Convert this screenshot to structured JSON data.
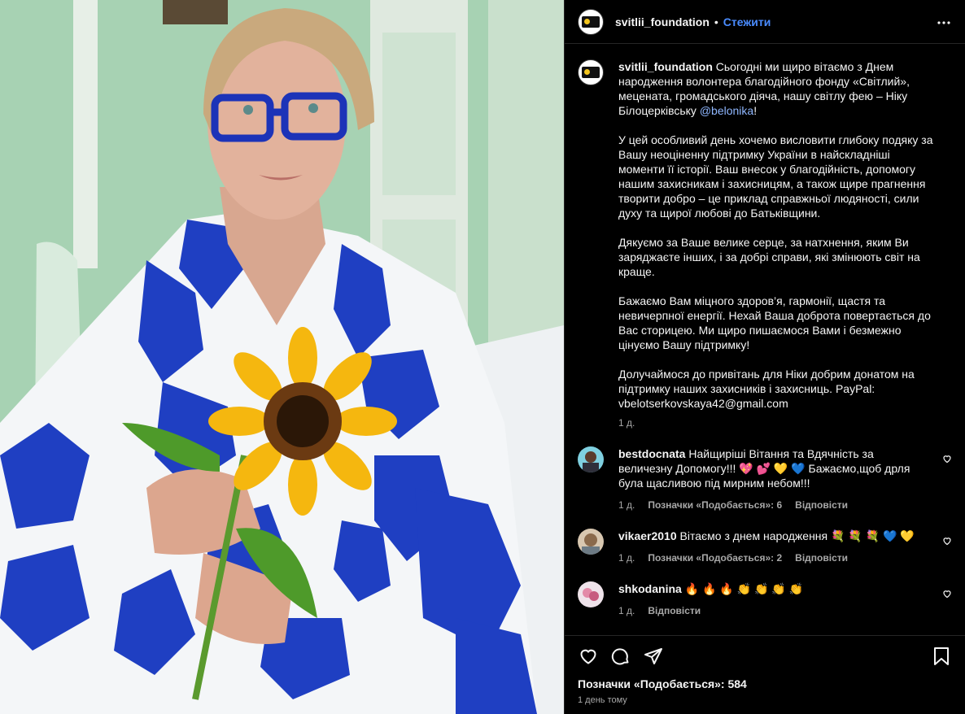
{
  "post": {
    "author": "svitlii_foundation",
    "follow_label": "Стежити",
    "separator": "•"
  },
  "caption": {
    "username": "svitlii_foundation",
    "text_1": " Сьогодні ми щиро вітаємо з Днем народження волонтера благодійного фонду «Світлий», мецената, громадського діяча, нашу світлу фею – Ніку Білоцерківську ",
    "mention": "@belonika",
    "text_2": "!\n\nУ цей особливий день хочемо висловити глибоку подяку за Вашу неоціненну підтримку України в найскладніші моменти її історії. Ваш внесок у благодійність, допомогу нашим захисникам і захисницям, а також щире прагнення творити добро – це приклад справжньої людяності, сили духу та щирої любові до Батьківщини.\n\nДякуємо за Ваше велике серце, за натхнення, яким Ви заряджаєте інших, і за добрі справи, які змінюють світ на краще.\n\nБажаємо Вам міцного здоров’я, гармонії, щастя та невичерпної енергії. Нехай Ваша доброта повертається до Вас сторицею. Ми щиро пишаємося Вами і безмежно цінуємо Вашу підтримку!\n\nДолучаймося до привітань для Ніки добрим донатом на підтримку наших захисників і захисниць. PayPal: vbelotserkovskaya42@gmail.com",
    "time": "1 д."
  },
  "comments": [
    {
      "username": "bestdocnata",
      "text": " Найщиріші Вітання та Вдячність за величезну Допомогу!!! 💖 💕 💛 💙 Бажаємо,щоб дрля була щасливою під мирним небом!!!",
      "time": "1 д.",
      "likes_label": "Позначки «Подобається»: 6",
      "reply_label": "Відповісти"
    },
    {
      "username": "vikaer2010",
      "text": " Вітаємо з днем народження 💐 💐 💐 💙 💛",
      "time": "1 д.",
      "likes_label": "Позначки «Подобається»: 2",
      "reply_label": "Відповісти"
    },
    {
      "username": "shkodanina",
      "text": " 🔥 🔥 🔥 👏 👏 👏 👏",
      "time": "1 д.",
      "reply_label": "Відповісти"
    }
  ],
  "footer": {
    "likes": "Позначки «Подобається»: 584",
    "date": "1 день тому"
  },
  "icons": {
    "more": "more-horizontal-icon",
    "like": "heart-outline-icon",
    "comment": "comment-bubble-icon",
    "share": "paper-plane-icon",
    "save": "bookmark-icon"
  },
  "colors": {
    "background": "#000000",
    "link": "#4a8cff",
    "muted": "#a8a8a8",
    "photo_wall": "#a9d3b4",
    "embroidery_blue": "#1f3fc2"
  }
}
